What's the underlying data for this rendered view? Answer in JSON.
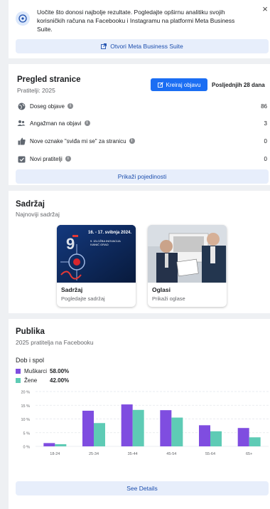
{
  "banner": {
    "text": "Uočite što donosi najbolje rezultate. Pogledajte opširnu analitiku svojih korisničkih računa na Facebooku i Instagramu na platformi Meta Business Suite.",
    "button_label": "Otvori Meta Business Suite",
    "close_label": "×"
  },
  "overview": {
    "title": "Pregled stranice",
    "subtitle": "Pratitelji: 2025",
    "create_label": "Kreiraj objavu",
    "period": "Posljednjih 28 dana",
    "metrics": [
      {
        "label": "Doseg objave",
        "value": "86",
        "icon": "globe-icon"
      },
      {
        "label": "Angažman na objavi",
        "value": "3",
        "icon": "people-icon"
      },
      {
        "label": "Nove oznake \"sviđa mi se\" za stranicu",
        "value": "0",
        "icon": "thumbs-up-icon"
      },
      {
        "label": "Novi pratitelji",
        "value": "0",
        "icon": "calendar-icon"
      }
    ],
    "details_label": "Prikaži pojedinosti"
  },
  "content": {
    "title": "Sadržaj",
    "subtitle": "Najnoviji sadržaj",
    "tiles": [
      {
        "title": "Sadržaj",
        "subtitle": "Pogledajte sadržaj",
        "poster_date": "16. - 17. svibnja 2024.",
        "poster_line1": "9. IZLOŽBA INOVACIJA",
        "poster_line2": "IVANIĆ GRAD"
      },
      {
        "title": "Oglasi",
        "subtitle": "Prikaži oglase"
      }
    ]
  },
  "audience": {
    "title": "Publika",
    "subtitle": "2025 pratitelja na Facebooku",
    "section": "Dob i spol",
    "see_details": "See Details"
  },
  "chart_data": {
    "type": "bar",
    "categories": [
      "18-24",
      "25-34",
      "35-44",
      "45-54",
      "55-64",
      "65+"
    ],
    "series": [
      {
        "name": "Muškarci",
        "total": "58.00%",
        "color": "#7f4de0",
        "values": [
          1.2,
          13,
          15.3,
          13.2,
          7.7,
          6.7
        ]
      },
      {
        "name": "Žene",
        "total": "42.00%",
        "color": "#5ecbb5",
        "values": [
          0.8,
          8.5,
          13.3,
          10.5,
          5.5,
          3.3
        ]
      }
    ],
    "yticks": [
      "0 %",
      "5 %",
      "10 %",
      "15 %",
      "20 %"
    ],
    "ylim": [
      0,
      20
    ],
    "grid": true
  }
}
